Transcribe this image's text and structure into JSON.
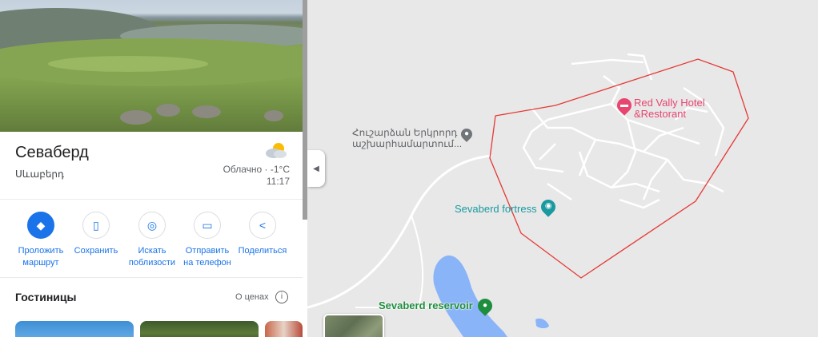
{
  "place": {
    "title": "Севаберд",
    "subtitle": "Սևաբերդ"
  },
  "weather": {
    "icon": "partly-cloudy-icon",
    "condition": "Облачно · -1°C",
    "time": "11:17"
  },
  "actions": [
    {
      "label1": "Проложить",
      "label2": "маршрут",
      "icon": "directions-icon"
    },
    {
      "label1": "Сохранить",
      "label2": "",
      "icon": "bookmark-icon"
    },
    {
      "label1": "Искать",
      "label2": "поблизости",
      "icon": "nearby-icon"
    },
    {
      "label1": "Отправить",
      "label2": "на телефон",
      "icon": "send-to-phone-icon"
    },
    {
      "label1": "Поделиться",
      "label2": "",
      "icon": "share-icon"
    }
  ],
  "hotels": {
    "title": "Гостиницы",
    "prices_label": "О ценах",
    "info_icon": "i"
  },
  "map": {
    "landmark_line1": "Հուշարձան Երկրորդ",
    "landmark_line2": "աշխարհամարտում...",
    "fortress": "Sevaberd fortress",
    "hotel_line1": "Red Vally Hotel",
    "hotel_line2": "&Restorant",
    "reservoir": "Sevaberd reservoir",
    "colors": {
      "boundary": "#e53935",
      "water": "#8ab4f8",
      "hotel_pin": "#e8456f",
      "fortress_pin": "#1a9aa0",
      "reservoir_pin": "#1e8e3e"
    }
  }
}
